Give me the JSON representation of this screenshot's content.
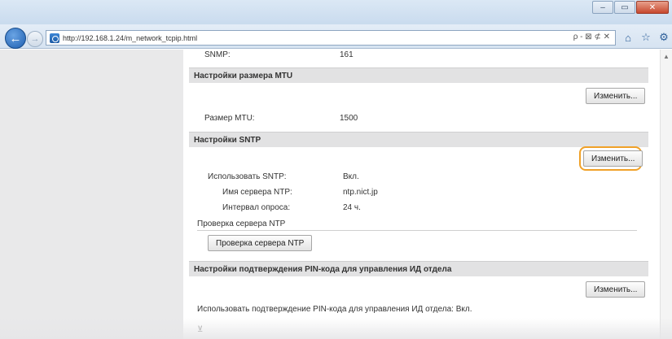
{
  "browser": {
    "url": "http://192.168.1.24/m_network_tcpip.html",
    "address_tools": "ρ - ⊠ ⊄ ✕",
    "home_icon": "home-icon",
    "favorites_icon": "star-icon",
    "settings_icon": "gear-icon"
  },
  "page": {
    "snmp_label": "SNMP:",
    "snmp_value": "161",
    "mtu_section": {
      "title": "Настройки размера MTU",
      "edit_label": "Изменить...",
      "mtu_label": "Размер MTU:",
      "mtu_value": "1500"
    },
    "sntp_section": {
      "title": "Настройки SNTP",
      "edit_label": "Изменить...",
      "use_sntp_label": "Использовать SNTP:",
      "use_sntp_value": "Вкл.",
      "ntp_server_label": "Имя сервера NTP:",
      "ntp_server_value": "ntp.nict.jp",
      "interval_label": "Интервал опроса:",
      "interval_value": "24 ч.",
      "check_title": "Проверка сервера NTP",
      "check_button": "Проверка сервера NTP"
    },
    "pin_section": {
      "title": "Настройки подтверждения PIN-кода для управления ИД отдела",
      "edit_label": "Изменить...",
      "use_pin_text": "Использовать подтверждение PIN-кода для управления ИД отдела:   Вкл."
    },
    "footer_glyph": "⊻"
  },
  "colors": {
    "highlight": "#f0a128",
    "section_bg": "#e2e2e3",
    "left_pane": "#e9e9ea"
  }
}
